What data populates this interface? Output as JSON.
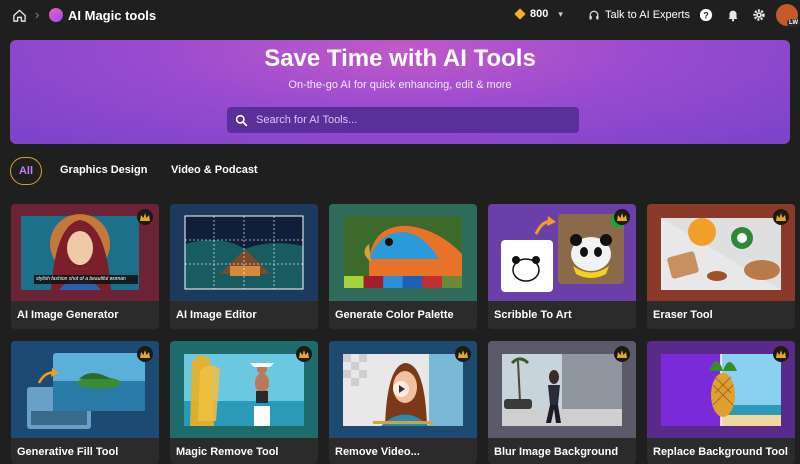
{
  "topbar": {
    "title": "AI Magic tools",
    "credits": "800",
    "experts_label": "Talk to AI Experts",
    "avatar_initials": "LW"
  },
  "hero": {
    "title": "Save Time with AI Tools",
    "subtitle": "On-the-go AI for quick enhancing, edit & more",
    "search_placeholder": "Search for AI Tools..."
  },
  "tabs": [
    "All",
    "Graphics Design",
    "Video & Podcast"
  ],
  "cards": [
    {
      "label": "AI Image Generator",
      "caption": "stylish fashion shot of a beautiful woman"
    },
    {
      "label": "AI Image Editor"
    },
    {
      "label": "Generate Color Palette"
    },
    {
      "label": "Scribble To Art"
    },
    {
      "label": "Eraser Tool"
    },
    {
      "label": "Generative Fill Tool"
    },
    {
      "label": "Magic Remove Tool"
    },
    {
      "label": "Remove Video..."
    },
    {
      "label": "Blur Image Background"
    },
    {
      "label": "Replace Background Tool"
    }
  ],
  "colors": {
    "accent_gold": "#d9a227",
    "credit_diamond": "#f4b128",
    "tab_all_text": "#c77dff",
    "hero_gradient": [
      "#c05ac8",
      "#7a43c9"
    ]
  }
}
